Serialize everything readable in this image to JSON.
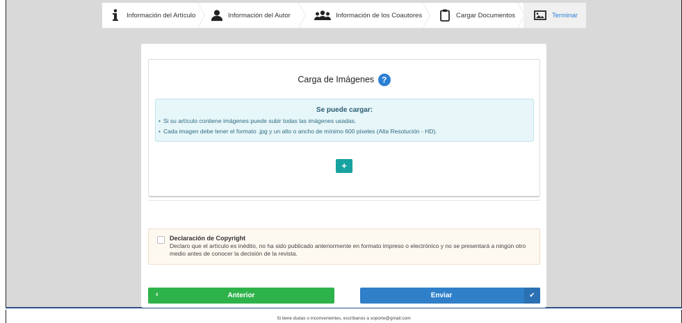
{
  "steps": [
    {
      "label": "Información del Artículo",
      "icon": "info-icon"
    },
    {
      "label": "Información del Autor",
      "icon": "user-icon"
    },
    {
      "label": "Información de los Coautores",
      "icon": "users-icon"
    },
    {
      "label": "Cargar Documentos",
      "icon": "clipboard-icon"
    },
    {
      "label": "Terminar",
      "icon": "image-icon",
      "active": true
    }
  ],
  "upload": {
    "title": "Carga de Imágenes",
    "help_icon": "?",
    "info_heading": "Se puede cargar:",
    "info_items": [
      "Si su artículo contiene imágenes puede subir todas las imágenes usadas.",
      "Cada imagen debe tener el formato .jpg y un alto o ancho de mínimo 600 pixeles (Alta Resolución - HD)."
    ],
    "add_label": "+"
  },
  "copyright": {
    "title": "Declaración de Copyright",
    "text": "Declaro que el artículo es inédito, no ha sido publicado anteriormente en formato impreso o electrónico y no se presentará a ningún otro medio antes de conocer la decisión de la revista.",
    "checked": false
  },
  "buttons": {
    "prev_label": "Anterior",
    "prev_icon": "‹",
    "send_label": "Enviar",
    "send_icon": "✔"
  },
  "footer": {
    "text": "Si tiene dudas o inconvenientes, escríbanos a soporte@gmail.com"
  },
  "colors": {
    "accent": "#2a7fd4",
    "prev": "#2eb34a",
    "send": "#2f7fc9",
    "add": "#17a2a0"
  }
}
